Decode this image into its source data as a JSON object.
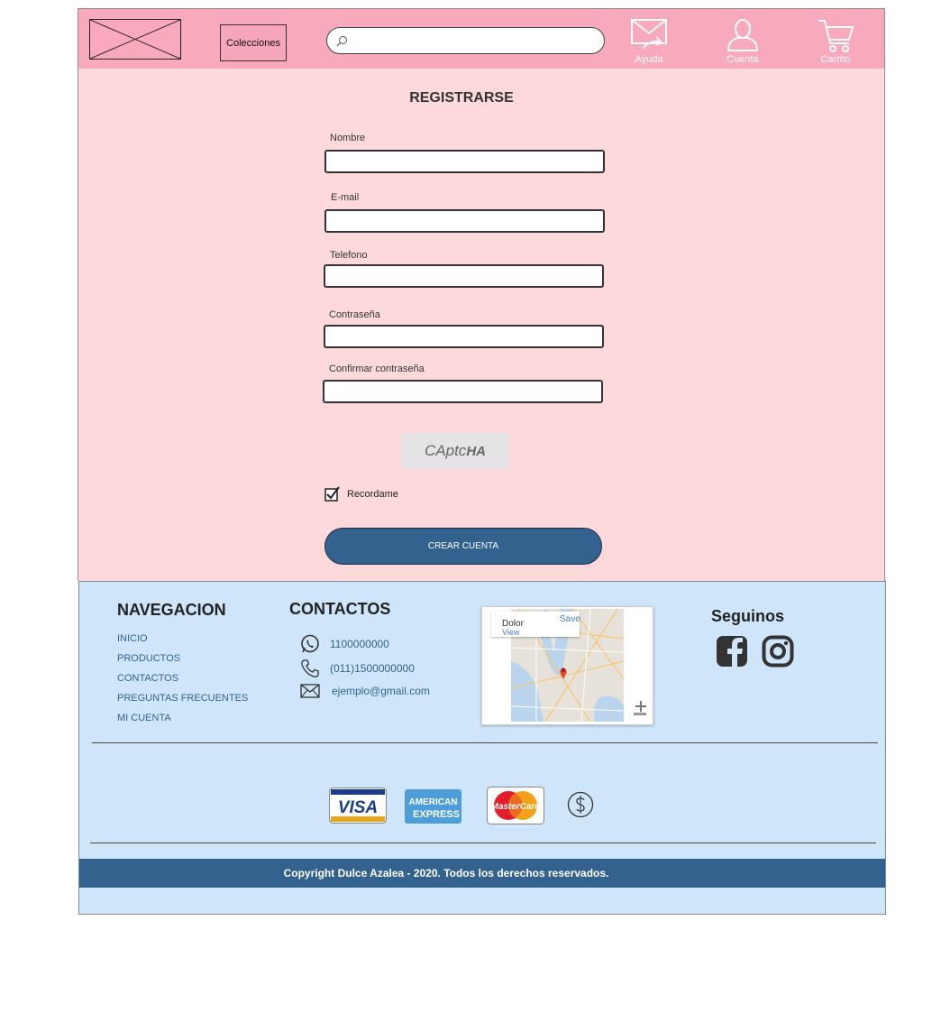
{
  "header": {
    "collections_label": "Colecciones",
    "search_placeholder": "",
    "help_label": "Ayuda",
    "account_label": "Cuenta",
    "cart_label": "Carrito"
  },
  "form": {
    "title": "REGISTRARSE",
    "fields": [
      {
        "label": "Nombre",
        "value": ""
      },
      {
        "label": "E-mail",
        "value": ""
      },
      {
        "label": "Telefono",
        "value": ""
      },
      {
        "label": "Contraseña",
        "value": ""
      },
      {
        "label": "Confirmar contraseña",
        "value": ""
      }
    ],
    "captcha_text_a": "CAptc",
    "captcha_text_b": "HA",
    "remember_label": "Recordame",
    "remember_checked": true,
    "submit_label": "CREAR CUENTA"
  },
  "footer": {
    "nav_title": "NAVEGACION",
    "nav_items": [
      "INICIO",
      "PRODUCTOS",
      "CONTACTOS",
      "PREGUNTAS FRECUENTES",
      "MI CUENTA"
    ],
    "contacts_title": "CONTACTOS",
    "contacts": [
      {
        "icon": "whatsapp-icon",
        "value": "1100000000"
      },
      {
        "icon": "phone-icon",
        "value": "(011)1500000000"
      },
      {
        "icon": "mail-icon",
        "value": "ejemplo@gmail.com"
      }
    ],
    "map": {
      "card_title": "Dolor",
      "card_link": "View",
      "save_label": "Save"
    },
    "social_title": "Seguinos",
    "social_icons": [
      "facebook-icon",
      "instagram-icon"
    ],
    "payment_icons": [
      "visa-icon",
      "american-express-icon",
      "mastercard-icon",
      "cash-icon"
    ],
    "visa_text": "VISA",
    "amex_text_a": "AMERICAN",
    "amex_text_b": "EXPRESS",
    "mastercard_text": "MasterCard",
    "copyright": "Copyright Dulce Azalea - 2020. Todos los derechos reservados."
  },
  "colors": {
    "header_bg": "#f9a9bc",
    "form_bg": "#fdd9dc",
    "footer_bg": "#cfe6fa",
    "primary_blue": "#33628f"
  }
}
